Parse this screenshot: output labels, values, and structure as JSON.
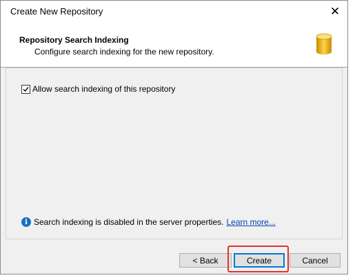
{
  "window": {
    "title": "Create New Repository"
  },
  "header": {
    "title": "Repository Search Indexing",
    "subtitle": "Configure search indexing for the new repository."
  },
  "content": {
    "checkbox_label": "Allow search indexing of this repository",
    "checkbox_checked": true,
    "info_text": "Search indexing is disabled in the server properties.",
    "info_link": "Learn more..."
  },
  "buttons": {
    "back": "< Back",
    "create": "Create",
    "cancel": "Cancel"
  },
  "colors": {
    "highlight": "#e4302b",
    "link": "#0645ad",
    "accent": "#0078d7"
  }
}
